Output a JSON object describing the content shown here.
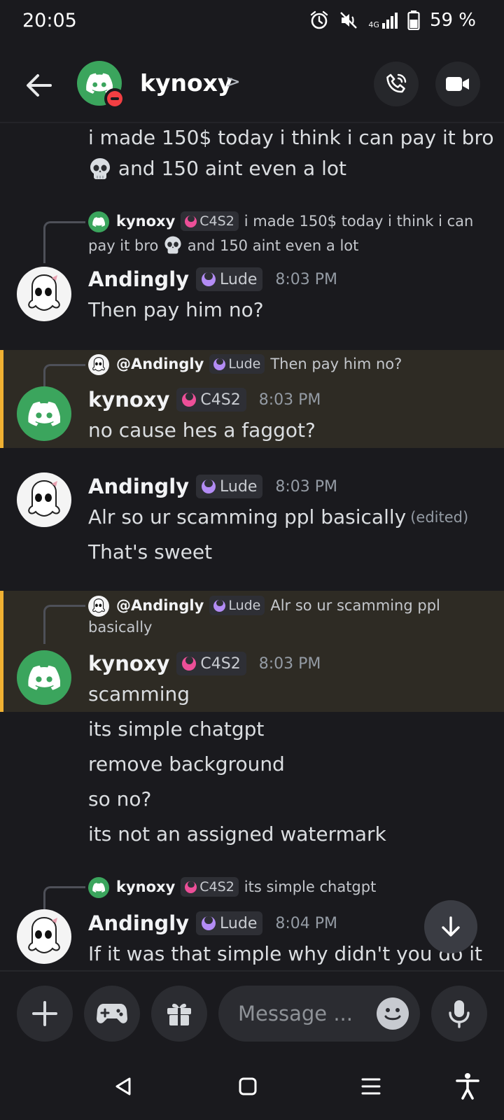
{
  "status_bar": {
    "time": "20:05",
    "network": "4G",
    "battery": "59 %"
  },
  "header": {
    "username": "kynoxy",
    "chevron": ">"
  },
  "messages": {
    "m0": {
      "line1": "i made 150$ today i think i can pay it bro",
      "line2": "and 150 aint even a lot"
    },
    "m1": {
      "reply": {
        "name": "kynoxy",
        "tag": "C4S2",
        "text1": "i made 150$ today i think i can",
        "text2a": "pay it bro",
        "text2b": "and 150 aint even a lot"
      },
      "author": "Andingly",
      "tag": "Lude",
      "time": "8:03 PM",
      "text": "Then pay him no?"
    },
    "m2": {
      "reply": {
        "name": "@Andingly",
        "tag": "Lude",
        "text": "Then pay him no?"
      },
      "author": "kynoxy",
      "tag": "C4S2",
      "time": "8:03 PM",
      "text": "no cause hes a faggot?"
    },
    "m3": {
      "author": "Andingly",
      "tag": "Lude",
      "time": "8:03 PM",
      "text": "Alr so ur scamming ppl basically",
      "edited": "(edited)",
      "text2": "That's sweet"
    },
    "m4": {
      "reply": {
        "name": "@Andingly",
        "tag": "Lude",
        "text1": "Alr so ur scamming ppl",
        "text2": "basically"
      },
      "author": "kynoxy",
      "tag": "C4S2",
      "time": "8:03 PM",
      "text": "scamming",
      "followups": [
        "its simple chatgpt",
        "remove background",
        "so no?",
        "its not an assigned watermark"
      ]
    },
    "m5": {
      "reply": {
        "name": "kynoxy",
        "tag": "C4S2",
        "text": "its simple chatgpt"
      },
      "author": "Andingly",
      "tag": "Lude",
      "time": "8:04 PM",
      "text": "If it was that simple why didn't you do it"
    }
  },
  "composer": {
    "placeholder": "Message ..."
  },
  "icons": {
    "back": "arrow-left-icon",
    "call": "phone-icon",
    "video": "video-camera-icon",
    "plus": "plus-icon",
    "game": "gamepad-icon",
    "gift": "gift-icon",
    "emoji": "emoji-icon",
    "mic": "microphone-icon",
    "scroll": "arrow-down-icon"
  },
  "colors": {
    "background": "#1a1a1e",
    "discord_green": "#3ba55d",
    "highlight": "#2e2b24",
    "mention_bar": "#f0b132",
    "dnd_red": "#f23f43"
  }
}
